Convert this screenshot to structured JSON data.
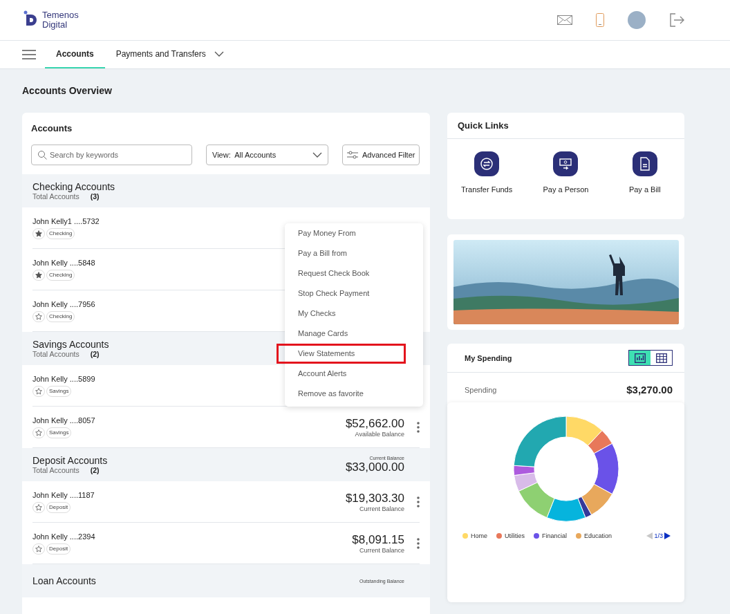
{
  "header": {
    "logo_line1": "Temenos",
    "logo_line2": "Digital"
  },
  "nav": {
    "tabs": [
      {
        "label": "Accounts",
        "selected": true,
        "dropdown": false
      },
      {
        "label": "Payments and Transfers",
        "selected": false,
        "dropdown": true
      }
    ]
  },
  "page_title": "Accounts Overview",
  "accounts": {
    "title": "Accounts",
    "search": {
      "placeholder": "Search by keywords"
    },
    "view": {
      "label": "View:",
      "value": "All Accounts"
    },
    "filter_button": "Advanced Filter",
    "groups": [
      {
        "title": "Checking Accounts",
        "total_label": "Total Accounts",
        "count": "(3)",
        "accounts": [
          {
            "name": "John Kelly1 ....5732",
            "favorite": true,
            "type": "Checking"
          },
          {
            "name": "John Kelly ....5848",
            "favorite": true,
            "type": "Checking"
          },
          {
            "name": "John Kelly ....7956",
            "favorite": false,
            "type": "Checking"
          }
        ]
      },
      {
        "title": "Savings Accounts",
        "total_label": "Total Accounts",
        "count": "(2)",
        "accounts": [
          {
            "name": "John Kelly ....5899",
            "favorite": false,
            "type": "Savings"
          },
          {
            "name": "John Kelly ....8057",
            "favorite": false,
            "type": "Savings",
            "balance": "$52,662.00",
            "balance_label": "Available Balance"
          }
        ]
      },
      {
        "title": "Deposit Accounts",
        "total_label": "Total Accounts",
        "count": "(2)",
        "balance_label": "Current Balance",
        "balance": "$33,000.00",
        "accounts": [
          {
            "name": "John Kelly ....1187",
            "favorite": false,
            "type": "Deposit",
            "balance": "$19,303.30",
            "balance_label": "Current Balance"
          },
          {
            "name": "John Kelly ....2394",
            "favorite": false,
            "type": "Deposit",
            "balance": "$8,091.15",
            "balance_label": "Current Balance"
          }
        ]
      },
      {
        "title": "Loan Accounts",
        "balance_label": "Outstanding Balance"
      }
    ]
  },
  "menu": {
    "items": [
      {
        "label": "Pay Money From",
        "highlighted": false
      },
      {
        "label": "Pay a Bill from",
        "highlighted": false
      },
      {
        "label": "Request Check Book",
        "highlighted": false
      },
      {
        "label": "Stop Check Payment",
        "highlighted": false
      },
      {
        "label": "My Checks",
        "highlighted": false
      },
      {
        "label": "Manage Cards",
        "highlighted": false
      },
      {
        "label": "View Statements",
        "highlighted": true
      },
      {
        "label": "Account Alerts",
        "highlighted": false
      },
      {
        "label": "Remove as favorite",
        "highlighted": false
      }
    ]
  },
  "quick_links": {
    "title": "Quick Links",
    "items": [
      {
        "kind": "transfer",
        "label": "Transfer Funds"
      },
      {
        "kind": "person",
        "label": "Pay a Person"
      },
      {
        "kind": "bill",
        "label": "Pay a Bill"
      }
    ]
  },
  "spending": {
    "title": "My Spending",
    "toggle": [
      {
        "kind": "chart",
        "selected": true
      },
      {
        "kind": "table",
        "selected": false
      }
    ],
    "label": "Spending",
    "amount": "$3,270.00",
    "legend": [
      {
        "label": "Home",
        "color": "#ffd966"
      },
      {
        "label": "Utilities",
        "color": "#e8785a"
      },
      {
        "label": "Financial",
        "color": "#6a52e8"
      },
      {
        "label": "Education",
        "color": "#e8a85c"
      }
    ],
    "pager": {
      "text": "1/3",
      "prev_enabled": false
    }
  }
}
